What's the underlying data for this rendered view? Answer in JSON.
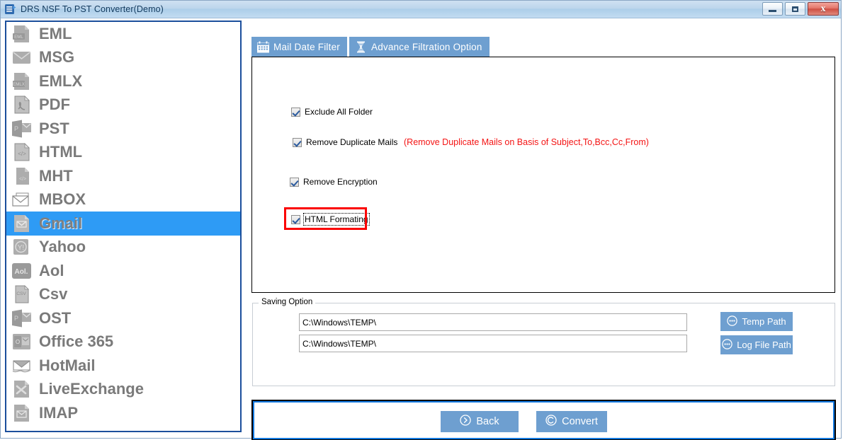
{
  "window": {
    "title": "DRS NSF To PST Converter(Demo)",
    "icon": "app-logo-icon",
    "controls": {
      "minimize": "minimize-button",
      "maximize": "maximize-button",
      "close_label": "x"
    }
  },
  "sidebar": {
    "items": [
      {
        "label": "EML",
        "icon": "eml-file-icon",
        "selected": false
      },
      {
        "label": "MSG",
        "icon": "msg-envelope-icon",
        "selected": false
      },
      {
        "label": "EMLX",
        "icon": "emlx-file-icon",
        "selected": false
      },
      {
        "label": "PDF",
        "icon": "pdf-file-icon",
        "selected": false
      },
      {
        "label": "PST",
        "icon": "pst-outlook-icon",
        "selected": false
      },
      {
        "label": "HTML",
        "icon": "html-code-file-icon",
        "selected": false
      },
      {
        "label": "MHT",
        "icon": "mht-code-file-icon",
        "selected": false
      },
      {
        "label": "MBOX",
        "icon": "mbox-envelope-icon",
        "selected": false
      },
      {
        "label": "Gmail",
        "icon": "gmail-envelope-icon",
        "selected": true
      },
      {
        "label": "Yahoo",
        "icon": "yahoo-circle-icon",
        "selected": false
      },
      {
        "label": "Aol",
        "icon": "aol-icon",
        "selected": false
      },
      {
        "label": "Csv",
        "icon": "csv-file-icon",
        "selected": false
      },
      {
        "label": "OST",
        "icon": "ost-outlook-icon",
        "selected": false
      },
      {
        "label": "Office 365",
        "icon": "office365-icon",
        "selected": false
      },
      {
        "label": "HotMail",
        "icon": "hotmail-envelope-icon",
        "selected": false
      },
      {
        "label": "LiveExchange",
        "icon": "liveexchange-file-icon",
        "selected": false
      },
      {
        "label": "IMAP",
        "icon": "imap-envelope-icon",
        "selected": false
      }
    ]
  },
  "tabs": [
    {
      "label": "Mail Date Filter",
      "icon": "calendar-icon",
      "active": false
    },
    {
      "label": "Advance Filtration Option",
      "icon": "filter-hourglass-icon",
      "active": true
    }
  ],
  "filters": {
    "exclude_all_folder": {
      "label": "Exclude All Folder",
      "checked": true
    },
    "remove_duplicate_mails": {
      "label": "Remove Duplicate Mails",
      "checked": true
    },
    "remove_duplicate_hint": "(Remove Duplicate Mails on  Basis of Subject,To,Bcc,Cc,From)",
    "remove_encryption": {
      "label": "Remove Encryption",
      "checked": true
    },
    "html_formating": {
      "label": "HTML Formating",
      "checked": true,
      "highlighted": true,
      "focused": true
    }
  },
  "saving_option": {
    "legend": "Saving Option",
    "temp_path_value": "C:\\Windows\\TEMP\\",
    "log_file_path_value": "C:\\Windows\\TEMP\\",
    "temp_path_button": {
      "label": "Temp Path",
      "icon": "dots-circle-icon"
    },
    "log_file_path_button": {
      "label": "Log File Path",
      "icon": "dots-circle-icon"
    }
  },
  "actions": {
    "back": {
      "label": "Back",
      "icon": "circle-arrow-right-icon"
    },
    "convert": {
      "label": "Convert",
      "icon": "circle-c-icon"
    }
  },
  "colors": {
    "accent_blue": "#6e9fd0",
    "selection_blue": "#2e9bf5",
    "panel_border_blue": "#1b4f9c",
    "hint_red": "#f41414",
    "highlight_red": "#fb0000",
    "titlebar_blue": "#bdd6ec"
  }
}
